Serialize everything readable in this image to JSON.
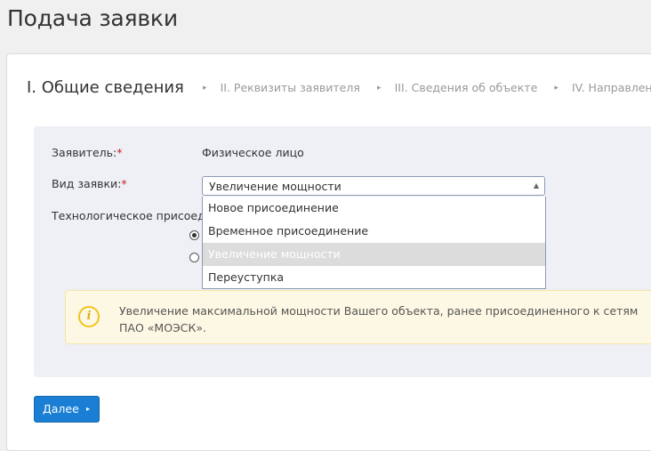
{
  "page": {
    "title": "Подача заявки"
  },
  "steps": {
    "active": "I. Общие сведения",
    "items": [
      "II. Реквизиты заявителя",
      "III. Сведения об объекте",
      "IV. Направленные доку"
    ],
    "separator": "▸"
  },
  "form": {
    "applicant": {
      "label": "Заявитель:",
      "required_mark": "*",
      "value": "Физическое лицо"
    },
    "request_type": {
      "label": "Вид заявки:",
      "required_mark": "*",
      "selected": "Увеличение мощности",
      "arrow": "▲",
      "options": [
        "Новое присоединение",
        "Временное присоединение",
        "Увеличение мощности",
        "Переуступка"
      ],
      "highlighted_index": 2
    },
    "tech_connection": {
      "label": "Технологическое присоедин"
    },
    "radios": [
      {
        "checked": true
      },
      {
        "checked": false
      }
    ]
  },
  "info": {
    "icon": "i",
    "text": "Увеличение максимальной мощности Вашего объекта, ранее присоединенного к сетям ПАО «МОЭСК»."
  },
  "actions": {
    "next_label": "Далее",
    "next_arrow": "▸"
  },
  "colors": {
    "primary_button": "#1a7fd4",
    "required": "#cc2222",
    "info_background": "#fdf8e4",
    "info_icon": "#f0c419",
    "panel_background": "#eef0f5"
  }
}
